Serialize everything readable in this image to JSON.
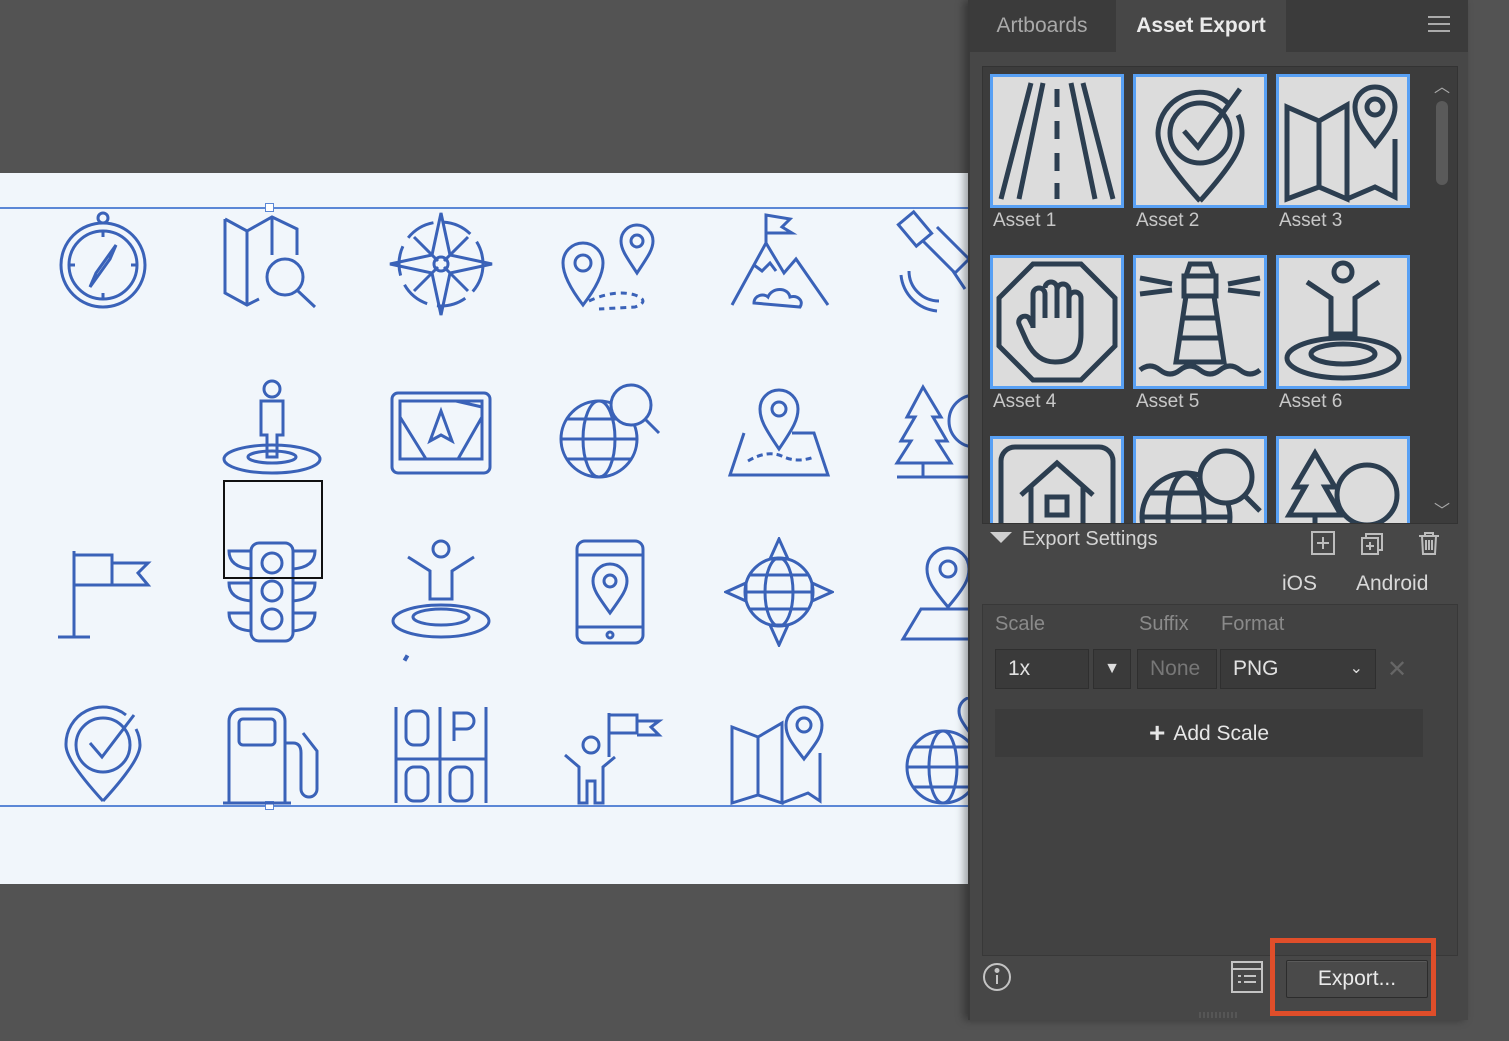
{
  "panel": {
    "tabs": [
      {
        "label": "Artboards",
        "active": false
      },
      {
        "label": "Asset Export",
        "active": true
      }
    ],
    "menu_icon": "hamburger-menu-icon",
    "assets": [
      {
        "label": "Asset 1",
        "icon": "road-icon"
      },
      {
        "label": "Asset 2",
        "icon": "location-check-icon"
      },
      {
        "label": "Asset 3",
        "icon": "map-pin-icon"
      },
      {
        "label": "Asset 4",
        "icon": "stop-hand-icon"
      },
      {
        "label": "Asset 5",
        "icon": "lighthouse-icon"
      },
      {
        "label": "Asset 6",
        "icon": "person-on-pin-icon"
      },
      {
        "label": "",
        "icon": "home-icon"
      },
      {
        "label": "",
        "icon": "globe-search-icon"
      },
      {
        "label": "",
        "icon": "trees-icon"
      }
    ],
    "export_settings": {
      "title": "Export Settings",
      "platforms": [
        "iOS",
        "Android"
      ],
      "columns": {
        "scale": "Scale",
        "suffix": "Suffix",
        "format": "Format"
      },
      "scale_value": "1x",
      "suffix_placeholder": "None",
      "format_value": "PNG",
      "add_scale_label": "Add Scale"
    },
    "footer": {
      "export_label": "Export..."
    }
  },
  "colors": {
    "icon_stroke": "#3a62b8",
    "selection_blue": "#58a0f4",
    "highlight": "#e04e2a"
  }
}
